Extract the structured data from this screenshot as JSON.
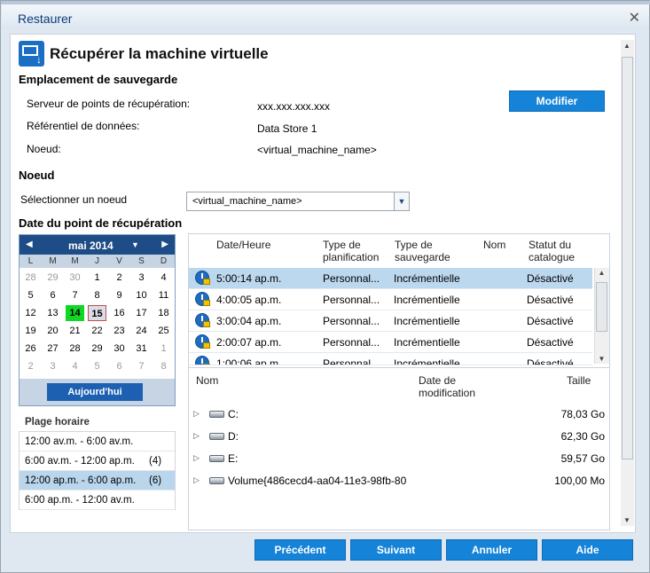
{
  "window": {
    "title": "Restaurer",
    "close": "✕"
  },
  "header": {
    "title": "Récupérer la machine virtuelle"
  },
  "backup_location": {
    "section_title": "Emplacement de sauvegarde",
    "server_label": "Serveur de points de récupération:",
    "server_value": "xxx.xxx.xxx.xxx",
    "datastore_label": "Référentiel de données:",
    "datastore_value": "Data Store 1",
    "node_label": "Noeud:",
    "node_value": "<virtual_machine_name>",
    "modify_button": "Modifier"
  },
  "node_section": {
    "title": "Noeud",
    "select_label": "Sélectionner un noeud",
    "select_value": "<virtual_machine_name>"
  },
  "recovery_date": {
    "title": "Date du point de récupération"
  },
  "calendar": {
    "month": "mai 2014",
    "days_of_week": [
      "L",
      "M",
      "M",
      "J",
      "V",
      "S",
      "D"
    ],
    "weeks": [
      [
        "28",
        "29",
        "30",
        "1",
        "2",
        "3",
        "4"
      ],
      [
        "5",
        "6",
        "7",
        "8",
        "9",
        "10",
        "11"
      ],
      [
        "12",
        "13",
        "14",
        "15",
        "16",
        "17",
        "18"
      ],
      [
        "19",
        "20",
        "21",
        "22",
        "23",
        "24",
        "25"
      ],
      [
        "26",
        "27",
        "28",
        "29",
        "30",
        "31",
        "1"
      ],
      [
        "2",
        "3",
        "4",
        "5",
        "6",
        "7",
        "8"
      ]
    ],
    "outside": [
      [
        0,
        0
      ],
      [
        0,
        1
      ],
      [
        0,
        2
      ],
      [
        4,
        6
      ],
      [
        5,
        0
      ],
      [
        5,
        1
      ],
      [
        5,
        2
      ],
      [
        5,
        3
      ],
      [
        5,
        4
      ],
      [
        5,
        5
      ],
      [
        5,
        6
      ]
    ],
    "selected": [
      2,
      2
    ],
    "today": [
      2,
      3
    ],
    "today_button": "Aujourd'hui"
  },
  "time_range": {
    "title": "Plage horaire",
    "items": [
      {
        "label": "12:00 av.m. - 6:00 av.m.",
        "count": ""
      },
      {
        "label": "6:00 av.m. - 12:00 ap.m.",
        "count": "(4)"
      },
      {
        "label": "12:00 ap.m. - 6:00 ap.m.",
        "count": "(6)"
      },
      {
        "label": "6:00 ap.m. - 12:00 av.m.",
        "count": ""
      }
    ]
  },
  "recovery_table": {
    "columns": [
      "Date/Heure",
      "Type de planification",
      "Type de sauvegarde",
      "Nom",
      "Statut du catalogue"
    ],
    "rows": [
      {
        "time": "5:00:14 ap.m.",
        "schedule": "Personnal...",
        "backup": "Incrémentielle",
        "name": "",
        "status": "Désactivé"
      },
      {
        "time": "4:00:05 ap.m.",
        "schedule": "Personnal...",
        "backup": "Incrémentielle",
        "name": "",
        "status": "Désactivé"
      },
      {
        "time": "3:00:04 ap.m.",
        "schedule": "Personnal...",
        "backup": "Incrémentielle",
        "name": "",
        "status": "Désactivé"
      },
      {
        "time": "2:00:07 ap.m.",
        "schedule": "Personnal...",
        "backup": "Incrémentielle",
        "name": "",
        "status": "Désactivé"
      },
      {
        "time": "1:00:06 ap.m.",
        "schedule": "Personnal...",
        "backup": "Incrémentielle",
        "name": "",
        "status": "Désactivé"
      }
    ]
  },
  "files_table": {
    "columns": [
      "Nom",
      "Date de modification",
      "Taille"
    ],
    "rows": [
      {
        "name": "C:",
        "date": "",
        "size": "78,03 Go"
      },
      {
        "name": "D:",
        "date": "",
        "size": "62,30 Go"
      },
      {
        "name": "E:",
        "date": "",
        "size": "59,57 Go"
      },
      {
        "name": "Volume{486cecd4-aa04-11e3-98fb-80",
        "date": "",
        "size": "100,00 Mo"
      }
    ]
  },
  "footer": {
    "previous": "Précédent",
    "next": "Suivant",
    "cancel": "Annuler",
    "help": "Aide"
  },
  "colors": {
    "accent": "#1583d8",
    "calendar_header": "#1d4c86",
    "selected_day": "#11d626",
    "selected_row": "#bcd8ee"
  }
}
